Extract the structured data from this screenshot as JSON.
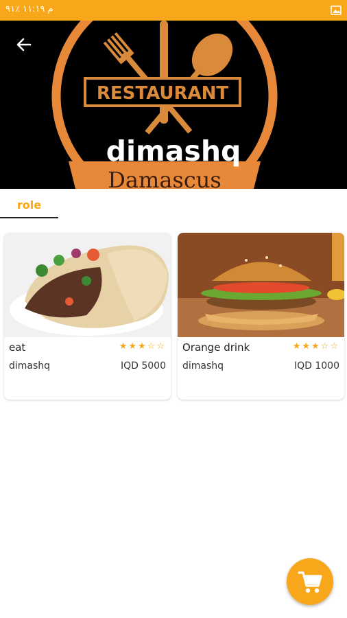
{
  "status_bar": {
    "time_text": "م ١١:١٩ ٪٩١"
  },
  "header": {
    "title": "dimashq",
    "logo_word": "RESTAURANT",
    "logo_city": "Damascus"
  },
  "tabs": [
    {
      "label": "role"
    }
  ],
  "products": [
    {
      "name": "eat",
      "vendor": "dimashq",
      "price": "IQD 5000",
      "stars": "★★★☆☆",
      "rating": 3,
      "max_rating": 5,
      "image": "shawarma-wrap"
    },
    {
      "name": "Orange drink",
      "vendor": "dimashq",
      "price": "IQD 1000",
      "stars": "★★★☆☆",
      "rating": 3,
      "max_rating": 5,
      "image": "burger"
    }
  ],
  "colors": {
    "accent": "#f8a71b",
    "header_bg": "#000000",
    "logo_orange": "#e8893a"
  },
  "icons": {
    "back": "arrow-left-icon",
    "cart": "cart-icon"
  }
}
